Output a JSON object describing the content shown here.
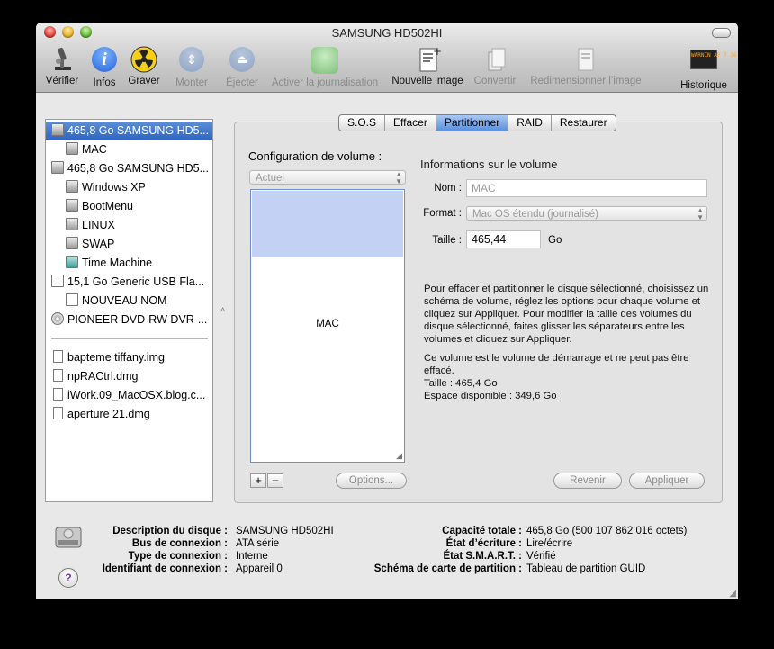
{
  "window": {
    "title": "SAMSUNG HD502HI"
  },
  "toolbar": {
    "verify": "Vérifier",
    "info": "Infos",
    "burn": "Graver",
    "mount": "Monter",
    "eject": "Éjecter",
    "journaling": "Activer la journalisation",
    "new_image": "Nouvelle image",
    "convert": "Convertir",
    "resize_image": "Redimensionner l’image",
    "log": "Historique",
    "log_icon_text": "WARNIN AY 7 36 1"
  },
  "sidebar": {
    "items": [
      {
        "label": "465,8 Go SAMSUNG HD5...",
        "icon": "hard-disk-icon",
        "selected": true
      },
      {
        "label": "MAC",
        "icon": "volume-icon"
      },
      {
        "label": "465,8 Go SAMSUNG HD5...",
        "icon": "hard-disk-icon"
      },
      {
        "label": "Windows XP",
        "icon": "volume-icon"
      },
      {
        "label": "BootMenu",
        "icon": "volume-icon"
      },
      {
        "label": "LINUX",
        "icon": "volume-icon"
      },
      {
        "label": "SWAP",
        "icon": "volume-icon"
      },
      {
        "label": "Time Machine",
        "icon": "time-machine-icon"
      },
      {
        "label": "15,1 Go Generic USB Fla...",
        "icon": "usb-disk-icon"
      },
      {
        "label": "NOUVEAU NOM",
        "icon": "volume-icon"
      },
      {
        "label": "PIONEER DVD-RW DVR-...",
        "icon": "optical-drive-icon"
      }
    ],
    "images": [
      {
        "label": "bapteme tiffany.img"
      },
      {
        "label": "npRACtrl.dmg"
      },
      {
        "label": "iWork.09_MacOSX.blog.c..."
      },
      {
        "label": "aperture 21.dmg"
      }
    ]
  },
  "tabs": [
    {
      "label": "S.O.S"
    },
    {
      "label": "Effacer"
    },
    {
      "label": "Partitionner",
      "active": true
    },
    {
      "label": "RAID"
    },
    {
      "label": "Restaurer"
    }
  ],
  "partition": {
    "config_label": "Configuration de volume :",
    "config_value": "Actuel",
    "volume_name": "MAC",
    "add": "+",
    "remove": "−",
    "options": "Options...",
    "info_title": "Informations sur le volume",
    "name_label": "Nom :",
    "name_value": "MAC",
    "format_label": "Format :",
    "format_value": "Mac OS étendu (journalisé)",
    "size_label": "Taille :",
    "size_value": "465,44",
    "size_unit": "Go",
    "help_1": "Pour effacer et partitionner le disque sélectionné, choisissez un schéma de volume, réglez les options pour chaque volume et cliquez sur Appliquer. Pour modifier la taille des volumes du disque sélectionné, faites glisser les séparateurs entre les volumes et cliquez sur Appliquer.",
    "help_2": "Ce volume est le volume de démarrage et ne peut pas être effacé.",
    "help_3": "Taille : 465,4 Go",
    "help_4": "Espace disponible : 349,6 Go",
    "revert": "Revenir",
    "apply": "Appliquer"
  },
  "details": {
    "desc_label": "Description du disque :",
    "desc_value": "SAMSUNG HD502HI",
    "bus_label": "Bus de connexion :",
    "bus_value": "ATA série",
    "type_label": "Type de connexion :",
    "type_value": "Interne",
    "id_label": "Identifiant de connexion :",
    "id_value": "Appareil 0",
    "cap_label": "Capacité totale :",
    "cap_value": "465,8 Go (500 107 862 016 octets)",
    "write_label": "État d’écriture :",
    "write_value": "Lire/écrire",
    "smart_label": "État S.M.A.R.T. :",
    "smart_value": "Vérifié",
    "scheme_label": "Schéma de carte de partition :",
    "scheme_value": "Tableau de partition GUID",
    "help_icon": "?"
  }
}
